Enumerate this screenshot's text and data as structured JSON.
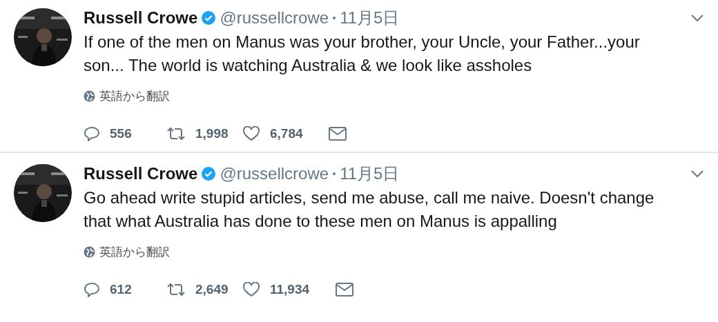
{
  "tweets": [
    {
      "name": "Russell Crowe",
      "verified": true,
      "handle": "@russellcrowe",
      "date": "11月5日",
      "text": "If one of the men on Manus was your brother, your Uncle, your Father...your son... The world is watching Australia & we look like assholes",
      "translate": "英語から翻訳",
      "replies": "556",
      "retweets": "1,998",
      "likes": "6,784"
    },
    {
      "name": "Russell Crowe",
      "verified": true,
      "handle": "@russellcrowe",
      "date": "11月5日",
      "text": "Go ahead write stupid articles, send me abuse, call me naive. Doesn't change that what Australia has done to these men on Manus is appalling",
      "translate": "英語から翻訳",
      "replies": "612",
      "retweets": "2,649",
      "likes": "11,934"
    }
  ]
}
